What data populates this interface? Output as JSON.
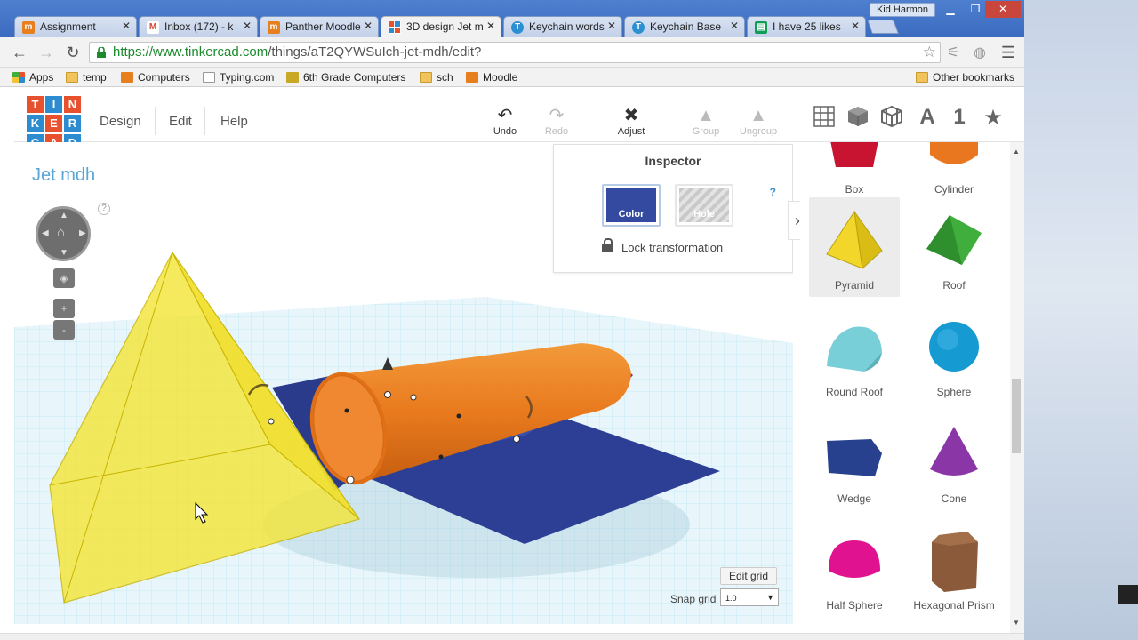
{
  "browser": {
    "user_name": "Kid Harmon",
    "tabs": [
      {
        "title": "Assignment",
        "icon": "moodle-icon",
        "color": "#e87f1e",
        "active": false
      },
      {
        "title": "Inbox (172) - k",
        "icon": "gmail-icon",
        "color": "#d44638",
        "active": false
      },
      {
        "title": "Panther Moodle",
        "icon": "moodle-icon",
        "color": "#e87f1e",
        "active": false
      },
      {
        "title": "3D design Jet m",
        "icon": "tinkercad-icon",
        "color": "#2c8fd1",
        "active": true
      },
      {
        "title": "Keychain words",
        "icon": "tinkercad-t-icon",
        "color": "#2c8fd1",
        "active": false
      },
      {
        "title": "Keychain Base",
        "icon": "tinkercad-t-icon",
        "color": "#2c8fd1",
        "active": false
      },
      {
        "title": "I have 25 likes",
        "icon": "sheets-icon",
        "color": "#0f9d58",
        "active": false
      }
    ],
    "url_host": "https://www.tinkercad.com",
    "url_path": "/things/aT2QYWSuIch-jet-mdh/edit?",
    "bookmarks": [
      {
        "label": "Apps",
        "icon": "apps-grid-icon"
      },
      {
        "label": "temp",
        "icon": "folder-icon"
      },
      {
        "label": "Computers",
        "icon": "moodle-icon"
      },
      {
        "label": "Typing.com",
        "icon": "page-icon"
      },
      {
        "label": "6th Grade Computers",
        "icon": "classroom-icon"
      },
      {
        "label": "sch",
        "icon": "folder-icon"
      },
      {
        "label": "Moodle",
        "icon": "moodle-icon"
      }
    ],
    "other_bookmarks": "Other bookmarks"
  },
  "app": {
    "logo_letters": [
      "T",
      "I",
      "N",
      "K",
      "E",
      "R",
      "C",
      "A",
      "D"
    ],
    "logo_colors": [
      "#e8512d",
      "#2d8ccf",
      "#e8512d",
      "#2d8ccf",
      "#e8512d",
      "#2d8ccf",
      "#2d8ccf",
      "#e8512d",
      "#2d8ccf"
    ],
    "menu": [
      "Design",
      "Edit",
      "Help"
    ],
    "toolbar": {
      "undo": "Undo",
      "redo": "Redo",
      "adjust": "Adjust",
      "group": "Group",
      "ungroup": "Ungroup"
    },
    "right_icons": [
      "grid-icon",
      "cube-icon",
      "wire-cube-icon",
      "letter-a-icon",
      "number-one-icon",
      "star-icon"
    ],
    "right_icon_text": {
      "letter": "A",
      "number": "1"
    }
  },
  "workplane": {
    "design_title": "Jet mdh",
    "help_mark": "?",
    "zoom_in": "+",
    "zoom_out": "-",
    "edit_grid": "Edit grid",
    "snap_grid_label": "Snap grid",
    "snap_grid_value": "1.0"
  },
  "inspector": {
    "title": "Inspector",
    "color_label": "Color",
    "color_value": "#334aa0",
    "hole_label": "Hole",
    "help": "?",
    "lock_label": "Lock transformation"
  },
  "shapes": [
    {
      "name": "Box",
      "color": "#c81430"
    },
    {
      "name": "Cylinder",
      "color": "#e8771f"
    },
    {
      "name": "Pyramid",
      "color": "#f2d62a",
      "selected": true
    },
    {
      "name": "Roof",
      "color": "#3fae3c"
    },
    {
      "name": "Round Roof",
      "color": "#79cfd8"
    },
    {
      "name": "Sphere",
      "color": "#169ad2"
    },
    {
      "name": "Wedge",
      "color": "#27418f"
    },
    {
      "name": "Cone",
      "color": "#8b36a6"
    },
    {
      "name": "Half Sphere",
      "color": "#e0128f"
    },
    {
      "name": "Hexagonal Prism",
      "color": "#8a5a3a"
    }
  ]
}
